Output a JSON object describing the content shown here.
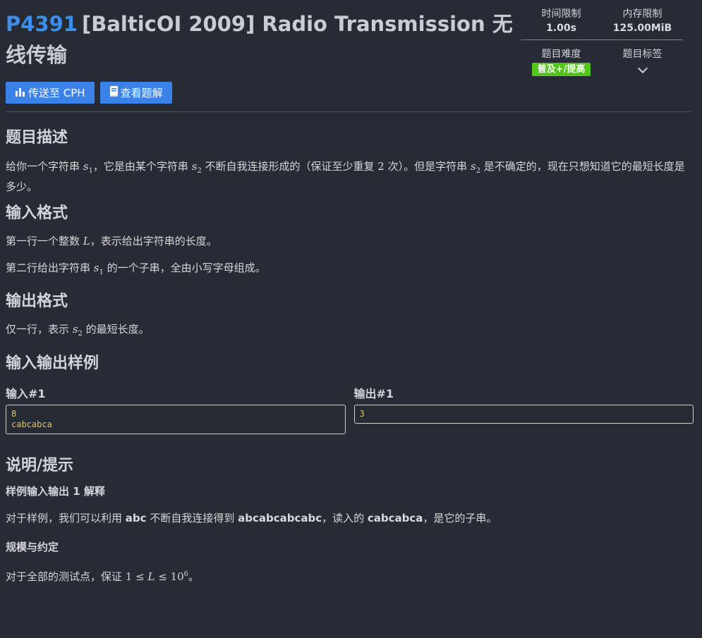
{
  "problem": {
    "id": "P4391",
    "title": "[BalticOI 2009] Radio Transmission 无线传输"
  },
  "buttons": {
    "send_cph": "传送至 CPH",
    "view_solution": "查看题解"
  },
  "stats": {
    "time_limit_label": "时间限制",
    "time_limit_value": "1.00s",
    "memory_limit_label": "内存限制",
    "memory_limit_value": "125.00MiB",
    "difficulty_label": "题目难度",
    "difficulty_value": "普及+/提高",
    "tags_label": "题目标签"
  },
  "colors": {
    "accent": "#3b8eea",
    "button": "#3b82e8",
    "difficulty_badge": "#52c41a",
    "background": "#272b35",
    "code_text": "#e0c36a"
  },
  "sections": {
    "description_heading": "题目描述",
    "description": {
      "t1": "给你一个字符串 ",
      "m1": "s",
      "m1_sub": "1",
      "t2": "，它是由某个字符串 ",
      "m2": "s",
      "m2_sub": "2",
      "t3": " 不断自我连接形成的（保证至少重复 ",
      "n1": "2",
      "t4": " 次）。但是字符串 ",
      "m3": "s",
      "m3_sub": "2",
      "t5": " 是不确定的，现在只想知道它的最短长度是多少。"
    },
    "input_heading": "输入格式",
    "input_line1": {
      "t1": "第一行一个整数 ",
      "m1": "L",
      "t2": "，表示给出字符串的长度。"
    },
    "input_line2": {
      "t1": "第二行给出字符串 ",
      "m1": "s",
      "m1_sub": "1",
      "t2": " 的一个子串，全由小写字母组成。"
    },
    "output_heading": "输出格式",
    "output_line": {
      "t1": "仅一行，表示 ",
      "m1": "s",
      "m1_sub": "2",
      "t2": " 的最短长度。"
    },
    "samples_heading": "输入输出样例",
    "sample_input_label": "输入#1",
    "sample_input": "8\ncabcabca",
    "sample_output_label": "输出#1",
    "sample_output": "3",
    "hint_heading": "说明/提示",
    "hint_sub1": "样例输入输出 1 解释",
    "hint_text1": {
      "t1": "对于样例，我们可以利用 ",
      "b1": "abc",
      "t2": " 不断自我连接得到 ",
      "b2": "abcabcabcabc",
      "t3": "，读入的 ",
      "b3": "cabcabca",
      "t4": "，是它的子串。"
    },
    "hint_sub2": "规模与约定",
    "hint_text2": {
      "t1": "对于全部的测试点，保证 ",
      "n1": "1",
      "op1": "≤",
      "m1": "L",
      "op2": "≤",
      "n2": "10",
      "n2_sup": "6",
      "t2": "。"
    }
  }
}
